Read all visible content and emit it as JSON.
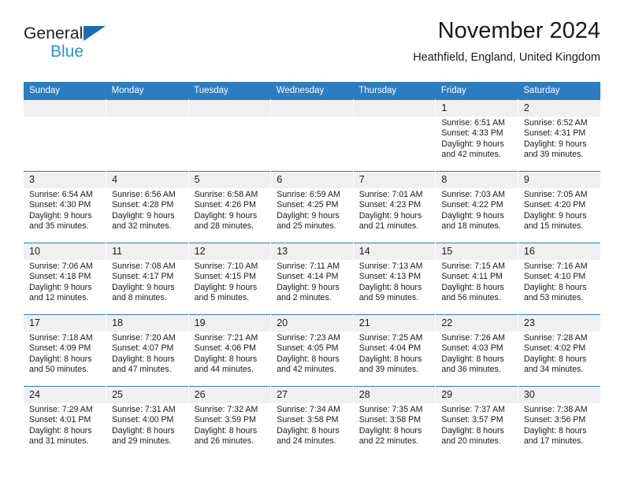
{
  "brand": {
    "name_top": "General",
    "name_bottom": "Blue",
    "logo_icon": "triangle-logo-icon"
  },
  "header": {
    "title": "November 2024",
    "location": "Heathfield, England, United Kingdom"
  },
  "colors": {
    "header_blue": "#2c7cc1",
    "daynum_band": "#f0f0f0",
    "brand_dark": "#231f20",
    "brand_blue": "#2a8fd8",
    "text": "#1a1a1a"
  },
  "weekdays": [
    "Sunday",
    "Monday",
    "Tuesday",
    "Wednesday",
    "Thursday",
    "Friday",
    "Saturday"
  ],
  "weeks": [
    [
      {
        "day": "",
        "sunrise": "",
        "sunset": "",
        "daylight1": "",
        "daylight2": "",
        "empty": true
      },
      {
        "day": "",
        "sunrise": "",
        "sunset": "",
        "daylight1": "",
        "daylight2": "",
        "empty": true
      },
      {
        "day": "",
        "sunrise": "",
        "sunset": "",
        "daylight1": "",
        "daylight2": "",
        "empty": true
      },
      {
        "day": "",
        "sunrise": "",
        "sunset": "",
        "daylight1": "",
        "daylight2": "",
        "empty": true
      },
      {
        "day": "",
        "sunrise": "",
        "sunset": "",
        "daylight1": "",
        "daylight2": "",
        "empty": true
      },
      {
        "day": "1",
        "sunrise": "Sunrise: 6:51 AM",
        "sunset": "Sunset: 4:33 PM",
        "daylight1": "Daylight: 9 hours",
        "daylight2": "and 42 minutes."
      },
      {
        "day": "2",
        "sunrise": "Sunrise: 6:52 AM",
        "sunset": "Sunset: 4:31 PM",
        "daylight1": "Daylight: 9 hours",
        "daylight2": "and 39 minutes."
      }
    ],
    [
      {
        "day": "3",
        "sunrise": "Sunrise: 6:54 AM",
        "sunset": "Sunset: 4:30 PM",
        "daylight1": "Daylight: 9 hours",
        "daylight2": "and 35 minutes."
      },
      {
        "day": "4",
        "sunrise": "Sunrise: 6:56 AM",
        "sunset": "Sunset: 4:28 PM",
        "daylight1": "Daylight: 9 hours",
        "daylight2": "and 32 minutes."
      },
      {
        "day": "5",
        "sunrise": "Sunrise: 6:58 AM",
        "sunset": "Sunset: 4:26 PM",
        "daylight1": "Daylight: 9 hours",
        "daylight2": "and 28 minutes."
      },
      {
        "day": "6",
        "sunrise": "Sunrise: 6:59 AM",
        "sunset": "Sunset: 4:25 PM",
        "daylight1": "Daylight: 9 hours",
        "daylight2": "and 25 minutes."
      },
      {
        "day": "7",
        "sunrise": "Sunrise: 7:01 AM",
        "sunset": "Sunset: 4:23 PM",
        "daylight1": "Daylight: 9 hours",
        "daylight2": "and 21 minutes."
      },
      {
        "day": "8",
        "sunrise": "Sunrise: 7:03 AM",
        "sunset": "Sunset: 4:22 PM",
        "daylight1": "Daylight: 9 hours",
        "daylight2": "and 18 minutes."
      },
      {
        "day": "9",
        "sunrise": "Sunrise: 7:05 AM",
        "sunset": "Sunset: 4:20 PM",
        "daylight1": "Daylight: 9 hours",
        "daylight2": "and 15 minutes."
      }
    ],
    [
      {
        "day": "10",
        "sunrise": "Sunrise: 7:06 AM",
        "sunset": "Sunset: 4:18 PM",
        "daylight1": "Daylight: 9 hours",
        "daylight2": "and 12 minutes."
      },
      {
        "day": "11",
        "sunrise": "Sunrise: 7:08 AM",
        "sunset": "Sunset: 4:17 PM",
        "daylight1": "Daylight: 9 hours",
        "daylight2": "and 8 minutes."
      },
      {
        "day": "12",
        "sunrise": "Sunrise: 7:10 AM",
        "sunset": "Sunset: 4:15 PM",
        "daylight1": "Daylight: 9 hours",
        "daylight2": "and 5 minutes."
      },
      {
        "day": "13",
        "sunrise": "Sunrise: 7:11 AM",
        "sunset": "Sunset: 4:14 PM",
        "daylight1": "Daylight: 9 hours",
        "daylight2": "and 2 minutes."
      },
      {
        "day": "14",
        "sunrise": "Sunrise: 7:13 AM",
        "sunset": "Sunset: 4:13 PM",
        "daylight1": "Daylight: 8 hours",
        "daylight2": "and 59 minutes."
      },
      {
        "day": "15",
        "sunrise": "Sunrise: 7:15 AM",
        "sunset": "Sunset: 4:11 PM",
        "daylight1": "Daylight: 8 hours",
        "daylight2": "and 56 minutes."
      },
      {
        "day": "16",
        "sunrise": "Sunrise: 7:16 AM",
        "sunset": "Sunset: 4:10 PM",
        "daylight1": "Daylight: 8 hours",
        "daylight2": "and 53 minutes."
      }
    ],
    [
      {
        "day": "17",
        "sunrise": "Sunrise: 7:18 AM",
        "sunset": "Sunset: 4:09 PM",
        "daylight1": "Daylight: 8 hours",
        "daylight2": "and 50 minutes."
      },
      {
        "day": "18",
        "sunrise": "Sunrise: 7:20 AM",
        "sunset": "Sunset: 4:07 PM",
        "daylight1": "Daylight: 8 hours",
        "daylight2": "and 47 minutes."
      },
      {
        "day": "19",
        "sunrise": "Sunrise: 7:21 AM",
        "sunset": "Sunset: 4:06 PM",
        "daylight1": "Daylight: 8 hours",
        "daylight2": "and 44 minutes."
      },
      {
        "day": "20",
        "sunrise": "Sunrise: 7:23 AM",
        "sunset": "Sunset: 4:05 PM",
        "daylight1": "Daylight: 8 hours",
        "daylight2": "and 42 minutes."
      },
      {
        "day": "21",
        "sunrise": "Sunrise: 7:25 AM",
        "sunset": "Sunset: 4:04 PM",
        "daylight1": "Daylight: 8 hours",
        "daylight2": "and 39 minutes."
      },
      {
        "day": "22",
        "sunrise": "Sunrise: 7:26 AM",
        "sunset": "Sunset: 4:03 PM",
        "daylight1": "Daylight: 8 hours",
        "daylight2": "and 36 minutes."
      },
      {
        "day": "23",
        "sunrise": "Sunrise: 7:28 AM",
        "sunset": "Sunset: 4:02 PM",
        "daylight1": "Daylight: 8 hours",
        "daylight2": "and 34 minutes."
      }
    ],
    [
      {
        "day": "24",
        "sunrise": "Sunrise: 7:29 AM",
        "sunset": "Sunset: 4:01 PM",
        "daylight1": "Daylight: 8 hours",
        "daylight2": "and 31 minutes."
      },
      {
        "day": "25",
        "sunrise": "Sunrise: 7:31 AM",
        "sunset": "Sunset: 4:00 PM",
        "daylight1": "Daylight: 8 hours",
        "daylight2": "and 29 minutes."
      },
      {
        "day": "26",
        "sunrise": "Sunrise: 7:32 AM",
        "sunset": "Sunset: 3:59 PM",
        "daylight1": "Daylight: 8 hours",
        "daylight2": "and 26 minutes."
      },
      {
        "day": "27",
        "sunrise": "Sunrise: 7:34 AM",
        "sunset": "Sunset: 3:58 PM",
        "daylight1": "Daylight: 8 hours",
        "daylight2": "and 24 minutes."
      },
      {
        "day": "28",
        "sunrise": "Sunrise: 7:35 AM",
        "sunset": "Sunset: 3:58 PM",
        "daylight1": "Daylight: 8 hours",
        "daylight2": "and 22 minutes."
      },
      {
        "day": "29",
        "sunrise": "Sunrise: 7:37 AM",
        "sunset": "Sunset: 3:57 PM",
        "daylight1": "Daylight: 8 hours",
        "daylight2": "and 20 minutes."
      },
      {
        "day": "30",
        "sunrise": "Sunrise: 7:38 AM",
        "sunset": "Sunset: 3:56 PM",
        "daylight1": "Daylight: 8 hours",
        "daylight2": "and 17 minutes."
      }
    ]
  ]
}
